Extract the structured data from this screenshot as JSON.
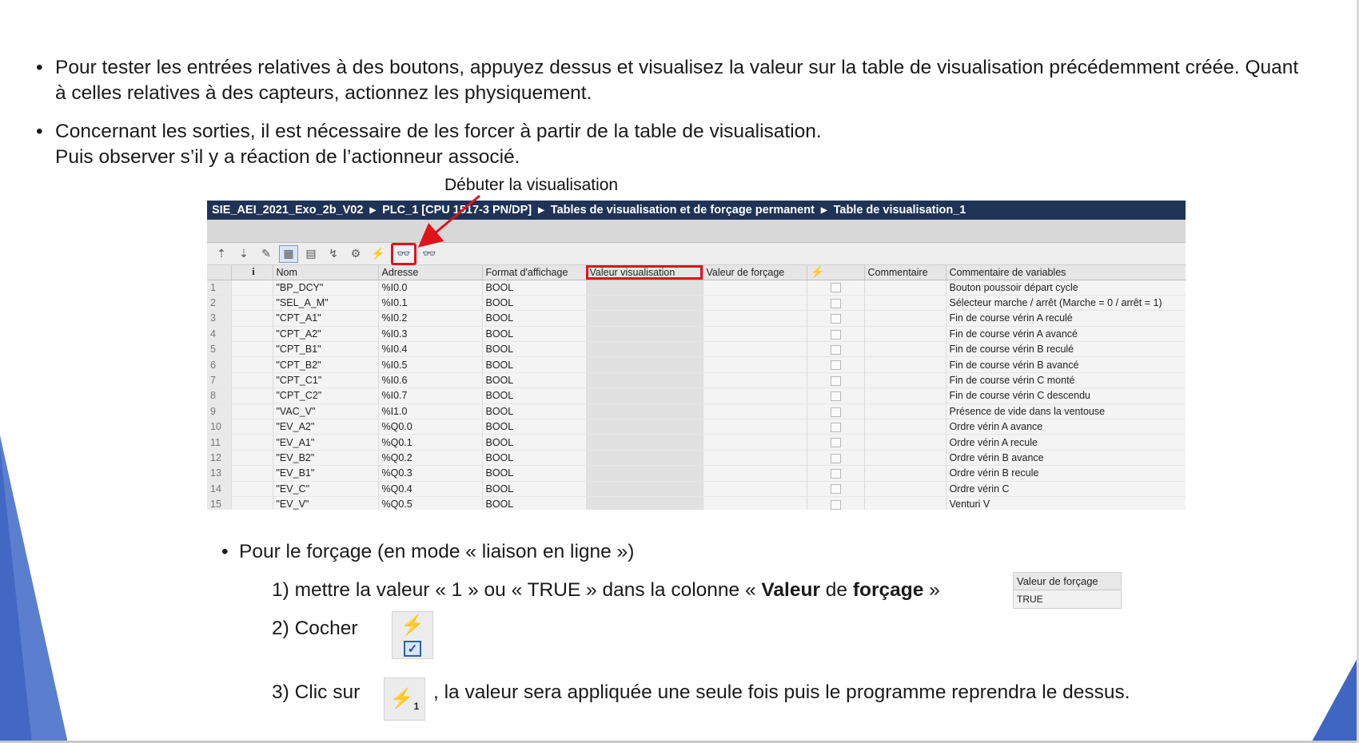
{
  "bullets": {
    "first": "Pour tester les entrées relatives à des boutons, appuyez dessus et visualisez la valeur sur la table de visualisation précédemment créée. Quant à celles relatives à des capteurs, actionnez les physiquement.",
    "second_line1": "Concernant les sorties, il est nécessaire de les forcer à partir de la table de visualisation.",
    "second_line2": "Puis observer s’il y a réaction de l’actionneur associé."
  },
  "annotation": "Débuter la visualisation",
  "screenshot": {
    "breadcrumb": [
      "SIE_AEI_2021_Exo_2b_V02",
      "PLC_1 [CPU 1517-3 PN/DP]",
      "Tables de visualisation et de forçage permanent",
      "Table de visualisation_1"
    ],
    "columns": {
      "info": "i",
      "nom": "Nom",
      "adresse": "Adresse",
      "format": "Format d'affichage",
      "valeur_visu": "Valeur visualisation",
      "valeur_forcage": "Valeur de forçage",
      "force_icon": "lightning-icon",
      "commentaire": "Commentaire",
      "commentaire_var": "Commentaire de variables"
    },
    "rows": [
      {
        "n": "1",
        "nom": "\"BP_DCY\"",
        "adresse": "%I0.0",
        "format": "BOOL",
        "comment": "Bouton poussoir départ cycle"
      },
      {
        "n": "2",
        "nom": "\"SEL_A_M\"",
        "adresse": "%I0.1",
        "format": "BOOL",
        "comment": "Sélecteur marche / arrêt (Marche = 0 / arrêt = 1)"
      },
      {
        "n": "3",
        "nom": "\"CPT_A1\"",
        "adresse": "%I0.2",
        "format": "BOOL",
        "comment": "Fin de course vérin A reculé"
      },
      {
        "n": "4",
        "nom": "\"CPT_A2\"",
        "adresse": "%I0.3",
        "format": "BOOL",
        "comment": "Fin de course vérin A avancé"
      },
      {
        "n": "5",
        "nom": "\"CPT_B1\"",
        "adresse": "%I0.4",
        "format": "BOOL",
        "comment": "Fin de course vérin B reculé"
      },
      {
        "n": "6",
        "nom": "\"CPT_B2\"",
        "adresse": "%I0.5",
        "format": "BOOL",
        "comment": "Fin de course vérin B avancé"
      },
      {
        "n": "7",
        "nom": "\"CPT_C1\"",
        "adresse": "%I0.6",
        "format": "BOOL",
        "comment": "Fin de course vérin C monté"
      },
      {
        "n": "8",
        "nom": "\"CPT_C2\"",
        "adresse": "%I0.7",
        "format": "BOOL",
        "comment": "Fin de course vérin C descendu"
      },
      {
        "n": "9",
        "nom": "\"VAC_V\"",
        "adresse": "%I1.0",
        "format": "BOOL",
        "comment": "Présence de vide dans la ventouse"
      },
      {
        "n": "10",
        "nom": "\"EV_A2\"",
        "adresse": "%Q0.0",
        "format": "BOOL",
        "comment": "Ordre vérin A avance"
      },
      {
        "n": "11",
        "nom": "\"EV_A1\"",
        "adresse": "%Q0.1",
        "format": "BOOL",
        "comment": "Ordre vérin A recule"
      },
      {
        "n": "12",
        "nom": "\"EV_B2\"",
        "adresse": "%Q0.2",
        "format": "BOOL",
        "comment": "Ordre vérin B avance"
      },
      {
        "n": "13",
        "nom": "\"EV_B1\"",
        "adresse": "%Q0.3",
        "format": "BOOL",
        "comment": "Ordre vérin B recule"
      },
      {
        "n": "14",
        "nom": "\"EV_C\"",
        "adresse": "%Q0.4",
        "format": "BOOL",
        "comment": "Ordre vérin C"
      },
      {
        "n": "15",
        "nom": "\"EV_V\"",
        "adresse": "%Q0.5",
        "format": "BOOL",
        "comment": "Venturi V"
      }
    ]
  },
  "forcing": {
    "title": "Pour le forçage (en mode « liaison en ligne »)",
    "step1_prefix": "1)  mettre la valeur « 1  » ou « TRUE » dans la colonne « ",
    "step1_bold1": "Valeur",
    "step1_mid": " de ",
    "step1_bold2": "forçage",
    "step1_suffix": " »",
    "mini_header": "Valeur de forçage",
    "mini_value": "TRUE",
    "step2": "2)  Cocher",
    "step3_prefix": "3) Clic sur",
    "step3_suffix": ", la valeur sera appliquée une seule fois puis le programme reprendra le dessus."
  },
  "colors": {
    "accent_red": "#e0131a",
    "title_bar": "#1f3356",
    "deco_blue": "#3f66c2"
  }
}
